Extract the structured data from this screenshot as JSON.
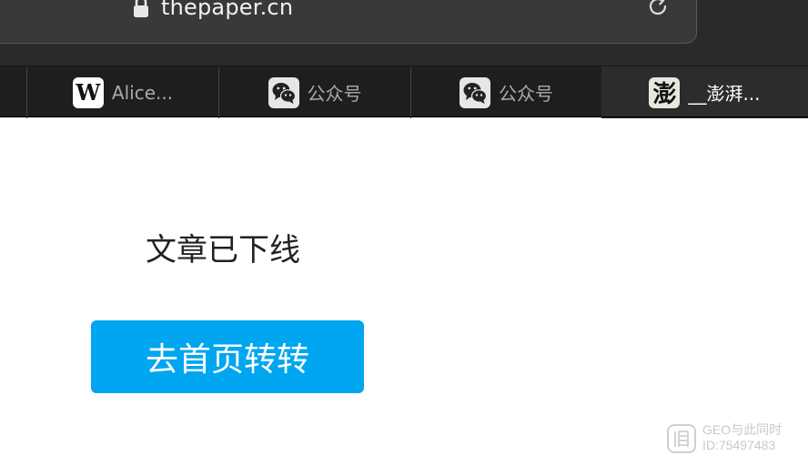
{
  "toolbar": {
    "url": "thepaper.cn",
    "lock_icon": "lock-icon",
    "reload_icon": "reload-icon"
  },
  "tabs": [
    {
      "label": "Alice...",
      "favicon": "W",
      "favicon_icon": "wikipedia-icon",
      "active": false
    },
    {
      "label": "公众号",
      "favicon_icon": "wechat-icon",
      "active": false
    },
    {
      "label": "公众号",
      "favicon_icon": "wechat-icon",
      "active": false
    },
    {
      "label": "__澎湃...",
      "favicon": "澎",
      "favicon_icon": "thepaper-icon",
      "active": true
    }
  ],
  "page": {
    "message": "文章已下线",
    "home_button": "去首页转转"
  },
  "watermark": {
    "line1": "GEO与此同时",
    "line2": "ID:75497483"
  },
  "colors": {
    "toolbar_bg": "#2b2a2a",
    "tabstrip_bg": "#1e1e1e",
    "button_blue": "#00a6ef",
    "message_text": "#222222"
  }
}
